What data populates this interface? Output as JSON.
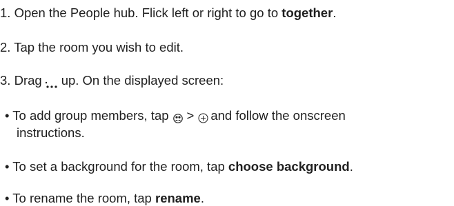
{
  "steps": [
    {
      "number": "1.",
      "text_before": "Open the People hub. Flick left or right to go to ",
      "bold": "together",
      "text_after": "."
    },
    {
      "number": "2.",
      "text": "Tap the room you wish to edit."
    },
    {
      "number": "3.",
      "text_before": "Drag",
      "icon": "more-dots-icon",
      "text_after": "up. On the displayed screen:"
    }
  ],
  "bullets": [
    {
      "bullet": "•",
      "text_before": "To add group members, tap",
      "icon1": "group-members-icon",
      "separator": ">",
      "icon2": "add-circle-icon",
      "text_after": "and follow the onscreen",
      "continuation": "instructions."
    },
    {
      "bullet": "•",
      "text_before": "To set a background for the room, tap ",
      "bold": "choose background",
      "text_after": "."
    },
    {
      "bullet": "•",
      "text_before": "To rename the room, tap ",
      "bold": "rename",
      "text_after": "."
    }
  ]
}
